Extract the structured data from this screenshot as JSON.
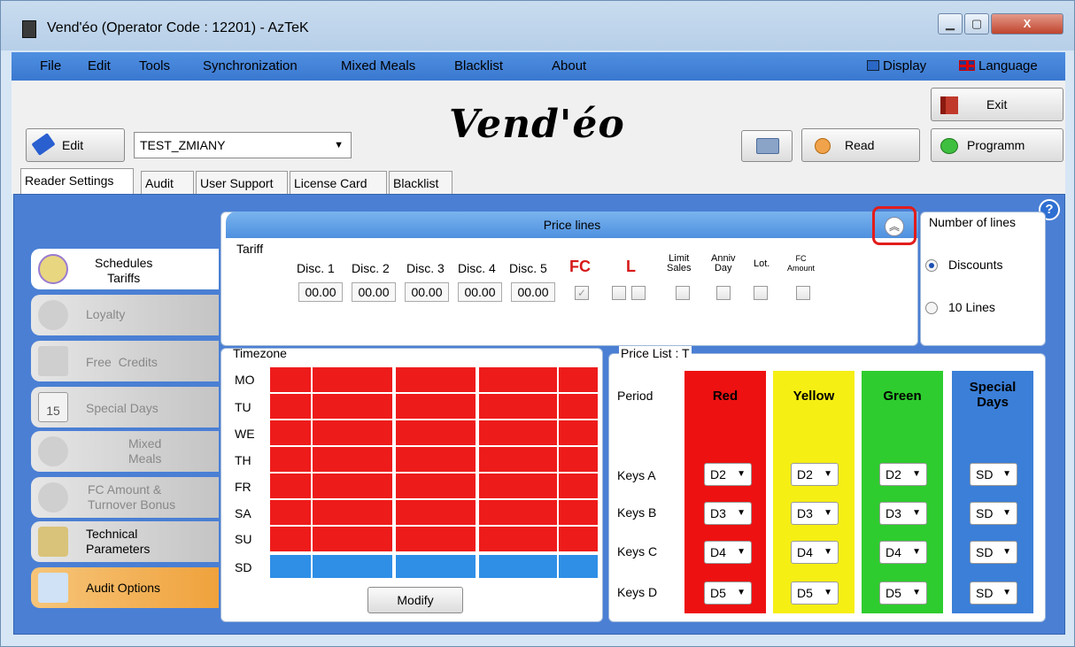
{
  "window": {
    "title": "Vend'éo (Operator Code : 12201) - AzTeK",
    "controls": [
      "▁",
      "▢",
      "X"
    ]
  },
  "menu": {
    "items": [
      "File",
      "Edit",
      "Tools",
      "Synchronization",
      "Mixed Meals",
      "Blacklist",
      "About"
    ],
    "display": "Display",
    "language": "Language"
  },
  "toolbar": {
    "edit_label": "Edit",
    "config_value": "TEST_ZMIANY",
    "logo": "Vend'éo",
    "read_label": "Read",
    "exit_label": "Exit",
    "program_label": "Programm"
  },
  "tabs": [
    "Reader Settings",
    "Audit",
    "User Support",
    "License Card",
    "Blacklist"
  ],
  "sidebar": {
    "items": [
      {
        "label": "Schedules\nTariffs",
        "active": true
      },
      {
        "label": "Loyalty"
      },
      {
        "label": "Free  Credits"
      },
      {
        "label": "Special Days"
      },
      {
        "label": "Mixed\nMeals"
      },
      {
        "label": "FC Amount &\nTurnover Bonus"
      },
      {
        "label": "Technical\nParameters"
      },
      {
        "label": "Audit Options"
      }
    ],
    "calendar_day": "15"
  },
  "price_lines": {
    "header": "Price lines",
    "tariff_label": "Tariff",
    "disc_labels": [
      "Disc. 1",
      "Disc. 2",
      "Disc. 3",
      "Disc. 4",
      "Disc. 5"
    ],
    "disc_values": [
      "00.00",
      "00.00",
      "00.00",
      "00.00",
      "00.00"
    ],
    "fc_label": "FC",
    "l_label": "L",
    "limit_sales": "Limit\nSales",
    "anniv_day": "Anniv\nDay",
    "lot": "Lot.",
    "fc_amount": "FC\nAmount"
  },
  "number_of_lines": {
    "label": "Number of lines",
    "options": [
      "Discounts",
      "10 Lines"
    ],
    "selected": 0
  },
  "timezone": {
    "label": "Timezone",
    "days": [
      "MO",
      "TU",
      "WE",
      "TH",
      "FR",
      "SA",
      "SU",
      "SD"
    ],
    "modify_label": "Modify",
    "colors": {
      "regular": "#ee1b1b",
      "special": "#2f8fe6"
    }
  },
  "price_list": {
    "label": "Price List : T",
    "period_label": "Period",
    "columns": [
      {
        "name": "Red",
        "color": "#ee1111",
        "text_color": "#000"
      },
      {
        "name": "Yellow",
        "color": "#f5ef14",
        "text_color": "#000"
      },
      {
        "name": "Green",
        "color": "#2ecc2e",
        "text_color": "#000"
      },
      {
        "name": "Special\nDays",
        "color": "#3b7fd8",
        "text_color": "#000"
      }
    ],
    "rows": [
      {
        "label": "Keys A",
        "values": [
          "D2",
          "D2",
          "D2",
          "SD"
        ]
      },
      {
        "label": "Keys B",
        "values": [
          "D3",
          "D3",
          "D3",
          "SD"
        ]
      },
      {
        "label": "Keys C",
        "values": [
          "D4",
          "D4",
          "D4",
          "SD"
        ]
      },
      {
        "label": "Keys D",
        "values": [
          "D5",
          "D5",
          "D5",
          "SD"
        ]
      }
    ]
  }
}
